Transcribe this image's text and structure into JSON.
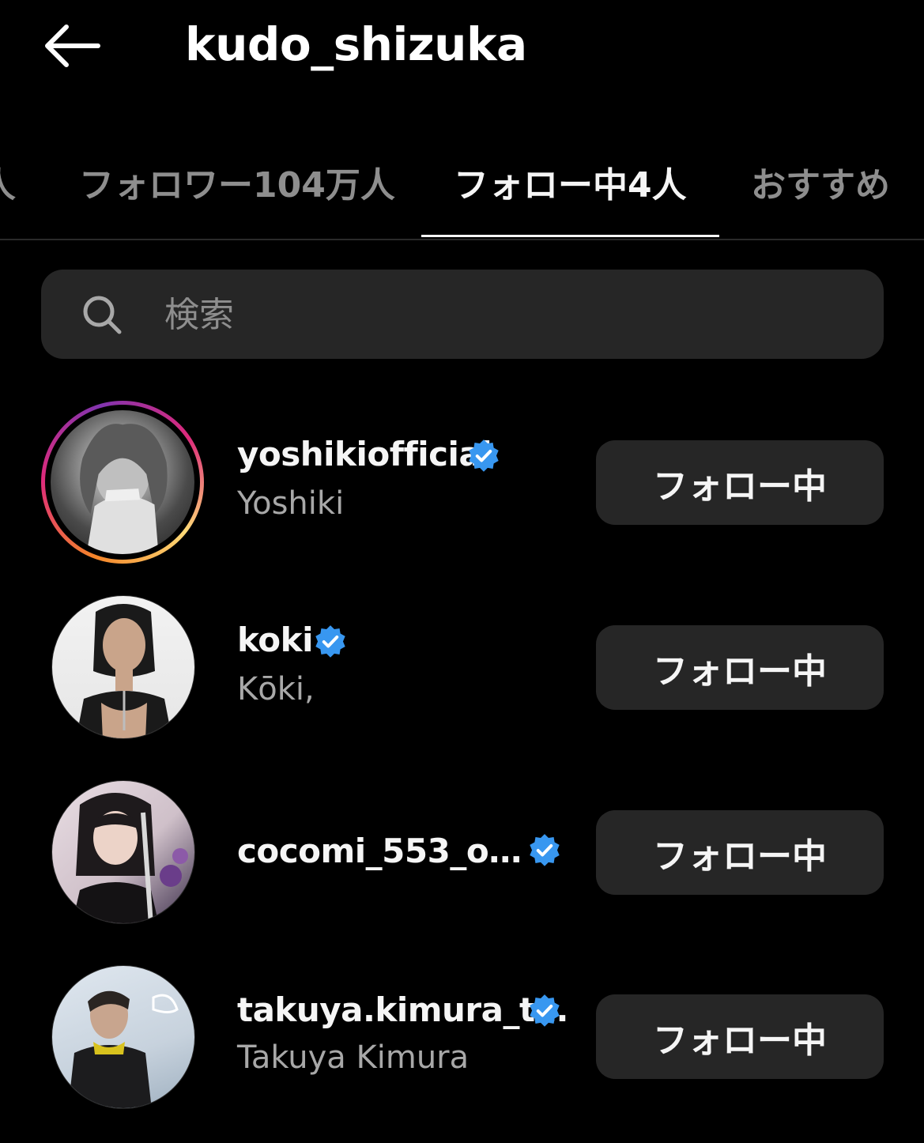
{
  "header": {
    "title": "kudo_shizuka"
  },
  "tabs": [
    {
      "label": "人"
    },
    {
      "label": "フォロワー104万人"
    },
    {
      "label": "フォロー中4人"
    },
    {
      "label": "おすすめ"
    }
  ],
  "search": {
    "placeholder": "検索"
  },
  "following": [
    {
      "username": "yoshikiofficial",
      "fullname": "Yoshiki",
      "verified": true,
      "has_story": true,
      "button": "フォロー中"
    },
    {
      "username": "koki",
      "fullname": "Kōki,",
      "verified": true,
      "has_story": false,
      "button": "フォロー中"
    },
    {
      "username": "cocomi_553_o…",
      "fullname": "",
      "verified": true,
      "has_story": false,
      "button": "フォロー中"
    },
    {
      "username": "takuya.kimura_t…",
      "fullname": "Takuya Kimura",
      "verified": true,
      "has_story": false,
      "button": "フォロー中"
    }
  ],
  "colors": {
    "background": "#000000",
    "button_bg": "#262626",
    "verified_blue": "#3897f0",
    "secondary_text": "#a8a8a8"
  },
  "icons": [
    "back-arrow-icon",
    "search-icon",
    "verified-badge-icon"
  ]
}
